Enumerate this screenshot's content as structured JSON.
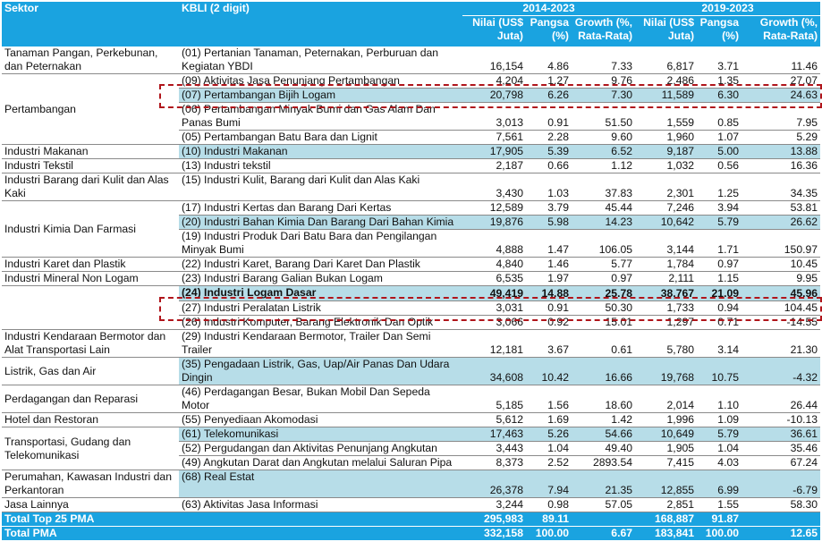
{
  "header": {
    "sektor": "Sektor",
    "kbli": "KBLI (2 digit)",
    "period1": "2014-2023",
    "period2": "2019-2023",
    "nilai": "Nilai (US$ Juta)",
    "pangsa": "Pangsa (%)",
    "growth": "Growth (%, Rata-Rata)"
  },
  "groups": [
    {
      "sektor": "Tanaman Pangan, Perkebunan, dan Peternakan",
      "rows": [
        {
          "kbli": "(01) Pertanian Tanaman, Peternakan, Perburuan dan Kegiatan YBDI",
          "v": [
            "16,154",
            "4.86",
            "7.33",
            "6,817",
            "3.71",
            "11.46"
          ]
        }
      ]
    },
    {
      "sektor": "Pertambangan",
      "rows": [
        {
          "kbli": "(09) Aktivitas Jasa Penunjang Pertambangan",
          "v": [
            "4,204",
            "1.27",
            "9.76",
            "2,486",
            "1.35",
            "27.07"
          ]
        },
        {
          "kbli": "(07) Pertambangan Bijih Logam",
          "v": [
            "20,798",
            "6.26",
            "7.30",
            "11,589",
            "6.30",
            "24.63"
          ],
          "shade": true
        },
        {
          "kbli": "(06) Pertambangan Minyak Bumi dan Gas Alam Dan Panas Bumi",
          "v": [
            "3,013",
            "0.91",
            "51.50",
            "1,559",
            "0.85",
            "7.95"
          ]
        },
        {
          "kbli": "(05) Pertambangan Batu Bara dan Lignit",
          "v": [
            "7,561",
            "2.28",
            "9.60",
            "1,960",
            "1.07",
            "5.29"
          ]
        }
      ]
    },
    {
      "sektor": "Industri Makanan",
      "rows": [
        {
          "kbli": "(10) Industri Makanan",
          "v": [
            "17,905",
            "5.39",
            "6.52",
            "9,187",
            "5.00",
            "13.88"
          ],
          "shade": true
        }
      ]
    },
    {
      "sektor": "Industri Tekstil",
      "rows": [
        {
          "kbli": "(13) Industri tekstil",
          "v": [
            "2,187",
            "0.66",
            "1.12",
            "1,032",
            "0.56",
            "16.36"
          ]
        }
      ]
    },
    {
      "sektor": "Industri Barang dari Kulit dan Alas Kaki",
      "rows": [
        {
          "kbli": "(15) Industri Kulit, Barang dari Kulit dan Alas Kaki",
          "v": [
            "3,430",
            "1.03",
            "37.83",
            "2,301",
            "1.25",
            "34.35"
          ]
        }
      ]
    },
    {
      "sektor": "Industri Kimia Dan Farmasi",
      "rows": [
        {
          "kbli": "(17) Industri Kertas dan Barang Dari Kertas",
          "v": [
            "12,589",
            "3.79",
            "45.44",
            "7,246",
            "3.94",
            "53.81"
          ]
        },
        {
          "kbli": "(20) Industri Bahan Kimia Dan Barang Dari Bahan Kimia",
          "v": [
            "19,876",
            "5.98",
            "14.23",
            "10,642",
            "5.79",
            "26.62"
          ],
          "shade": true
        },
        {
          "kbli": "(19) Industri Produk Dari Batu Bara dan Pengilangan Minyak Bumi",
          "v": [
            "4,888",
            "1.47",
            "106.05",
            "3,144",
            "1.71",
            "150.97"
          ]
        }
      ]
    },
    {
      "sektor": "Industri Karet dan Plastik",
      "rows": [
        {
          "kbli": "(22) Industri Karet, Barang Dari Karet Dan Plastik",
          "v": [
            "4,840",
            "1.46",
            "5.77",
            "1,784",
            "0.97",
            "10.45"
          ]
        }
      ]
    },
    {
      "sektor": "Industri Mineral Non Logam",
      "rows": [
        {
          "kbli": "(23) Industri Barang Galian Bukan Logam",
          "v": [
            "6,535",
            "1.97",
            "0.97",
            "2,111",
            "1.15",
            "9.95"
          ]
        }
      ]
    },
    {
      "sektor": "",
      "rows": [
        {
          "kbli": "(24) Industri Logam Dasar",
          "v": [
            "49,419",
            "14.88",
            "25.78",
            "38,767",
            "21.09",
            "45.96"
          ],
          "shade": true,
          "bold": true
        },
        {
          "kbli": "(27) Industri Peralatan Listrik",
          "v": [
            "3,031",
            "0.91",
            "50.30",
            "1,733",
            "0.94",
            "104.45"
          ]
        },
        {
          "kbli": "(26) Industri Komputer, Barang Elektronik Dan Optik",
          "v": [
            "3,066",
            "0.92",
            "15.01",
            "1,297",
            "0.71",
            "-14.55"
          ]
        }
      ]
    },
    {
      "sektor": "Industri Kendaraan Bermotor dan Alat Transportasi Lain",
      "rows": [
        {
          "kbli": "(29) Industri Kendaraan Bermotor, Trailer Dan Semi Trailer",
          "v": [
            "12,181",
            "3.67",
            "0.61",
            "5,780",
            "3.14",
            "21.30"
          ]
        }
      ]
    },
    {
      "sektor": "Listrik, Gas dan Air",
      "rows": [
        {
          "kbli": "(35) Pengadaan Listrik, Gas, Uap/Air Panas Dan Udara Dingin",
          "v": [
            "34,608",
            "10.42",
            "16.66",
            "19,768",
            "10.75",
            "-4.32"
          ],
          "shade": true
        }
      ]
    },
    {
      "sektor": "Perdagangan dan Reparasi",
      "rows": [
        {
          "kbli": "(46) Perdagangan Besar, Bukan Mobil Dan Sepeda Motor",
          "v": [
            "5,185",
            "1.56",
            "18.60",
            "2,014",
            "1.10",
            "26.44"
          ]
        }
      ]
    },
    {
      "sektor": "Hotel dan Restoran",
      "rows": [
        {
          "kbli": "(55) Penyediaan Akomodasi",
          "v": [
            "5,612",
            "1.69",
            "1.42",
            "1,996",
            "1.09",
            "-10.13"
          ]
        }
      ]
    },
    {
      "sektor": "Transportasi, Gudang dan Telekomunikasi",
      "rows": [
        {
          "kbli": "(61) Telekomunikasi",
          "v": [
            "17,463",
            "5.26",
            "54.66",
            "10,649",
            "5.79",
            "36.61"
          ],
          "shade": true
        },
        {
          "kbli": "(52) Pergudangan dan Aktivitas Penunjang Angkutan",
          "v": [
            "3,443",
            "1.04",
            "49.40",
            "1,905",
            "1.04",
            "35.46"
          ]
        },
        {
          "kbli": "(49) Angkutan Darat dan Angkutan melalui Saluran Pipa",
          "v": [
            "8,373",
            "2.52",
            "2893.54",
            "7,415",
            "4.03",
            "67.24"
          ]
        }
      ]
    },
    {
      "sektor": "Perumahan, Kawasan Industri dan Perkantoran",
      "rows": [
        {
          "kbli": "(68) Real Estat",
          "v": [
            "26,378",
            "7.94",
            "21.35",
            "12,855",
            "6.99",
            "-6.79"
          ],
          "shade": true
        }
      ]
    },
    {
      "sektor": "Jasa Lainnya",
      "rows": [
        {
          "kbli": "(63) Aktivitas Jasa Informasi",
          "v": [
            "3,244",
            "0.98",
            "57.05",
            "2,851",
            "1.55",
            "58.30"
          ]
        }
      ]
    }
  ],
  "totals": [
    {
      "label": "Total Top 25 PMA",
      "v": [
        "295,983",
        "89.11",
        "",
        "168,887",
        "91.87",
        ""
      ]
    },
    {
      "label": "Total PMA",
      "v": [
        "332,158",
        "100.00",
        "6.67",
        "183,841",
        "100.00",
        "12.65"
      ]
    }
  ]
}
